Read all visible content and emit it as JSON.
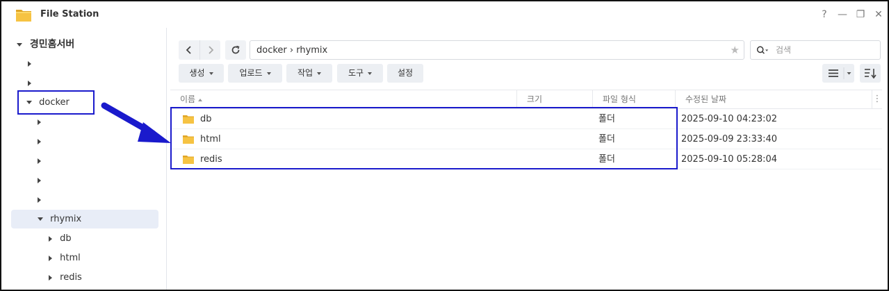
{
  "window": {
    "title": "File Station",
    "controls": [
      "?",
      "—",
      "❐",
      "✕"
    ]
  },
  "sidebar": {
    "root": "경민홈서버",
    "docker": "docker",
    "rhymix": "rhymix",
    "children": [
      "db",
      "html",
      "redis"
    ]
  },
  "toolbar": {
    "path": "docker › rhymix",
    "search_placeholder": "검색",
    "buttons": [
      {
        "label": "생성",
        "caret": true
      },
      {
        "label": "업로드",
        "caret": true
      },
      {
        "label": "작업",
        "caret": true
      },
      {
        "label": "도구",
        "caret": true
      },
      {
        "label": "설정",
        "caret": false
      }
    ]
  },
  "table": {
    "columns": [
      "이름",
      "크기",
      "파일 형식",
      "수정된 날짜"
    ],
    "rows": [
      {
        "name": "db",
        "size": "",
        "type": "폴더",
        "modified": "2025-09-10 04:23:02"
      },
      {
        "name": "html",
        "size": "",
        "type": "폴더",
        "modified": "2025-09-09 23:33:40"
      },
      {
        "name": "redis",
        "size": "",
        "type": "폴더",
        "modified": "2025-09-10 05:28:04"
      }
    ]
  },
  "colors": {
    "annotation": "#1a1acc",
    "folder": "#f6c343",
    "selected_bg": "#e8edf7"
  },
  "icons": [
    "folder-icon",
    "star-icon",
    "search-icon",
    "refresh-icon",
    "chevron-left-icon",
    "chevron-right-icon",
    "list-view-icon",
    "sort-icon"
  ]
}
